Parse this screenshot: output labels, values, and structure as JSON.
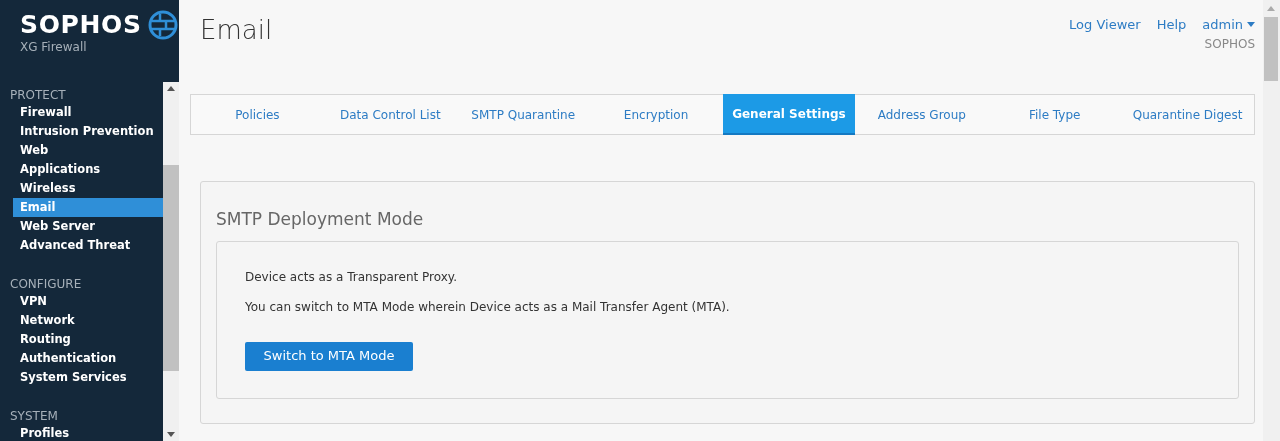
{
  "brand": {
    "name": "SOPHOS",
    "product": "XG Firewall"
  },
  "sidebar": {
    "sections": [
      {
        "title": "PROTECT",
        "items": [
          {
            "label": "Firewall",
            "selected": false
          },
          {
            "label": "Intrusion Prevention",
            "selected": false
          },
          {
            "label": "Web",
            "selected": false
          },
          {
            "label": "Applications",
            "selected": false
          },
          {
            "label": "Wireless",
            "selected": false
          },
          {
            "label": "Email",
            "selected": true
          },
          {
            "label": "Web Server",
            "selected": false
          },
          {
            "label": "Advanced Threat",
            "selected": false
          }
        ]
      },
      {
        "title": "CONFIGURE",
        "items": [
          {
            "label": "VPN",
            "selected": false
          },
          {
            "label": "Network",
            "selected": false
          },
          {
            "label": "Routing",
            "selected": false
          },
          {
            "label": "Authentication",
            "selected": false
          },
          {
            "label": "System Services",
            "selected": false
          }
        ]
      },
      {
        "title": "SYSTEM",
        "items": [
          {
            "label": "Profiles",
            "selected": false
          }
        ]
      }
    ]
  },
  "page_title": "Email",
  "header_links": [
    "Log Viewer",
    "Help"
  ],
  "user": {
    "name": "admin",
    "org": "SOPHOS"
  },
  "tabs": [
    {
      "label": "Policies",
      "selected": false
    },
    {
      "label": "Data Control List",
      "selected": false
    },
    {
      "label": "SMTP Quarantine",
      "selected": false
    },
    {
      "label": "Encryption",
      "selected": false
    },
    {
      "label": "General Settings",
      "selected": true
    },
    {
      "label": "Address Group",
      "selected": false
    },
    {
      "label": "File Type",
      "selected": false
    },
    {
      "label": "Quarantine Digest",
      "selected": false
    }
  ],
  "panel": {
    "title": "SMTP Deployment Mode",
    "lines": [
      "Device acts as a Transparent Proxy.",
      "You can switch to MTA Mode wherein Device acts as a Mail Transfer Agent (MTA)."
    ],
    "button": "Switch to MTA Mode"
  }
}
